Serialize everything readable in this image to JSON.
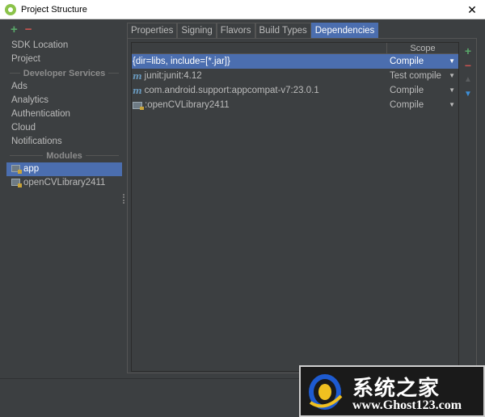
{
  "window": {
    "title": "Project Structure",
    "close_label": "✕"
  },
  "left_toolbar": {
    "add": "+",
    "remove": "−"
  },
  "left_panel": {
    "top_items": [
      {
        "label": "SDK Location"
      },
      {
        "label": "Project"
      }
    ],
    "developer_services_header": "Developer Services",
    "developer_services": [
      {
        "label": "Ads"
      },
      {
        "label": "Analytics"
      },
      {
        "label": "Authentication"
      },
      {
        "label": "Cloud"
      },
      {
        "label": "Notifications"
      }
    ],
    "modules_header": "Modules",
    "modules": [
      {
        "label": "app",
        "selected": true
      },
      {
        "label": "openCVLibrary2411",
        "selected": false
      }
    ]
  },
  "tabs": [
    {
      "label": "Properties"
    },
    {
      "label": "Signing"
    },
    {
      "label": "Flavors"
    },
    {
      "label": "Build Types"
    },
    {
      "label": "Dependencies",
      "active": true
    }
  ],
  "dependencies": {
    "scope_header": "Scope",
    "rows": [
      {
        "name": "{dir=libs, include=[*.jar]}",
        "scope": "Compile",
        "icon": "none",
        "selected": true
      },
      {
        "name": "junit:junit:4.12",
        "scope": "Test compile",
        "icon": "maven-icon",
        "selected": false
      },
      {
        "name": "com.android.support:appcompat-v7:23.0.1",
        "scope": "Compile",
        "icon": "maven-icon",
        "selected": false
      },
      {
        "name": ":openCVLibrary2411",
        "scope": "Compile",
        "icon": "module-folder-icon",
        "selected": false
      }
    ]
  },
  "side_tools": {
    "add": "+",
    "remove": "−",
    "up": "▲",
    "down": "▼"
  },
  "watermark": {
    "chinese_text": "系统之家",
    "url": "www.Ghost123.com"
  },
  "colors": {
    "selection": "#4b6eaf",
    "background": "#3c3f41",
    "add": "#59a869",
    "remove": "#c75450"
  }
}
